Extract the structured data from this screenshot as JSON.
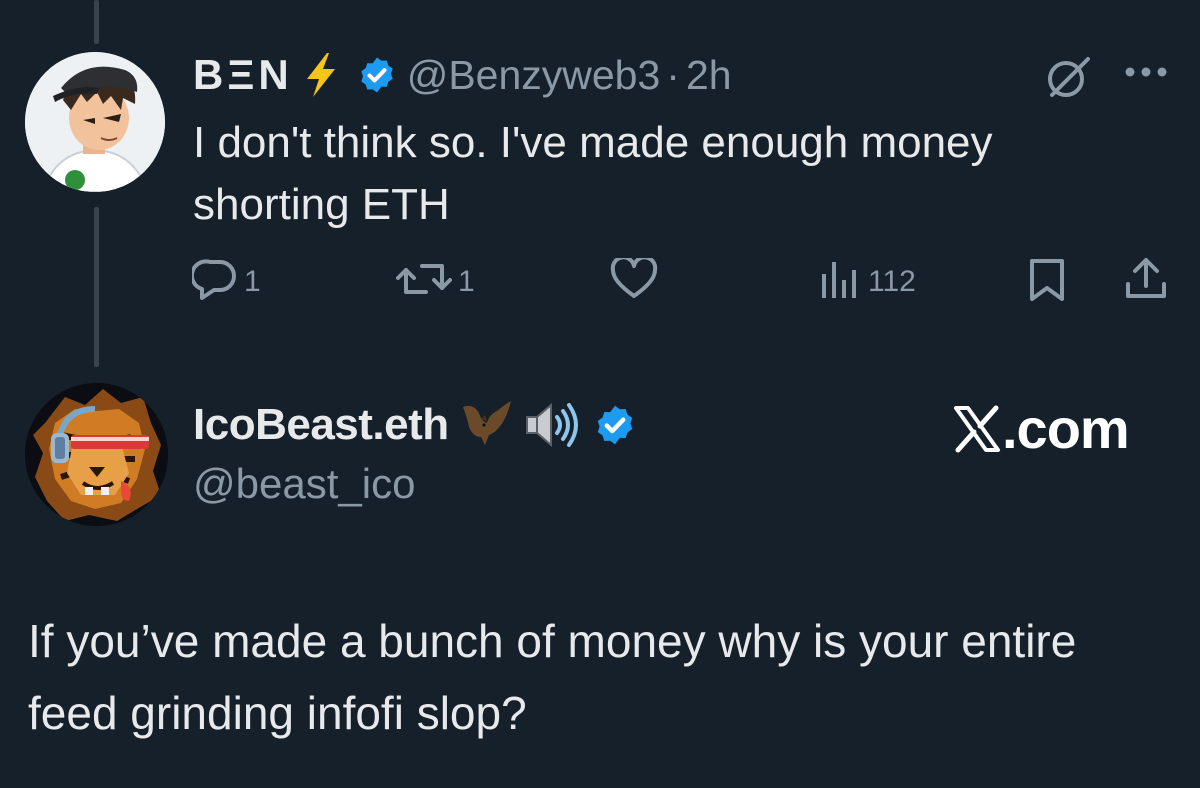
{
  "tweet_1": {
    "display_name": "BΞN",
    "handle": "@Benzyweb3",
    "separator": "·",
    "timestamp": "2h",
    "text": "I don't think so. I've made enough money shorting ETH",
    "actions": {
      "reply_count": "1",
      "retweet_count": "1",
      "like_count": "",
      "views_count": "112"
    },
    "icons": [
      "lightning-bolt-icon",
      "verified-badge-icon",
      "grok-icon",
      "more-icon",
      "reply-icon",
      "retweet-icon",
      "like-icon",
      "views-icon",
      "bookmark-icon",
      "share-icon"
    ]
  },
  "tweet_2": {
    "display_name": "IcoBeast.eth",
    "handle": "@beast_ico",
    "text": "If you’ve made a bunch of money why is your entire feed grinding infofi slop?",
    "icons": [
      "bat-emoji-icon",
      "speaker-emoji-icon",
      "verified-badge-icon"
    ]
  },
  "watermark": {
    "logo_letter": "𝕏",
    "suffix": ".com"
  },
  "colors": {
    "background": "#15202b",
    "text_primary": "#e7e9ea",
    "text_secondary": "#8b98a5",
    "verified_blue": "#1d9bf0",
    "bolt_yellow": "#f5c518",
    "thread_line": "#38444d"
  }
}
